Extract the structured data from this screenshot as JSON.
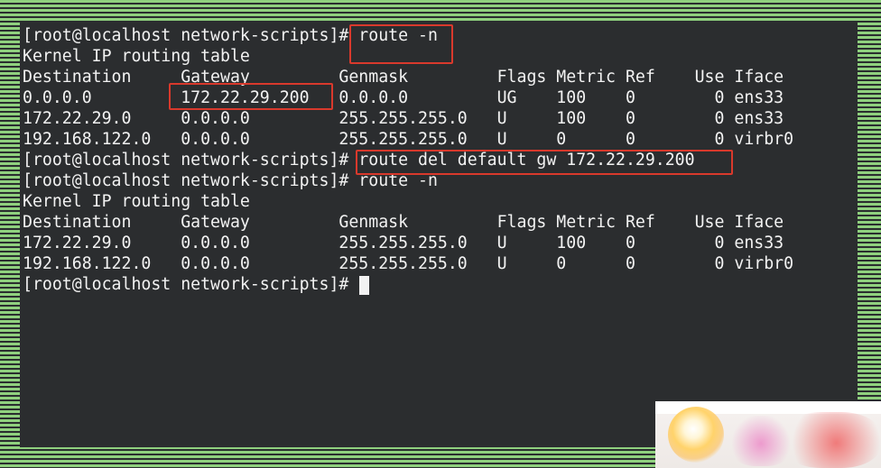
{
  "terminal": {
    "lines": [
      "[root@localhost network-scripts]# route -n",
      "Kernel IP routing table",
      "Destination     Gateway         Genmask         Flags Metric Ref    Use Iface",
      "0.0.0.0         172.22.29.200   0.0.0.0         UG    100    0        0 ens33",
      "172.22.29.0     0.0.0.0         255.255.255.0   U     100    0        0 ens33",
      "192.168.122.0   0.0.0.0         255.255.255.0   U     0      0        0 virbr0",
      "[root@localhost network-scripts]# route del default gw 172.22.29.200",
      "[root@localhost network-scripts]# route -n",
      "Kernel IP routing table",
      "Destination     Gateway         Genmask         Flags Metric Ref    Use Iface",
      "172.22.29.0     0.0.0.0         255.255.255.0   U     100    0        0 ens33",
      "192.168.122.0   0.0.0.0         255.255.255.0   U     0      0        0 virbr0",
      "[root@localhost network-scripts]# "
    ]
  },
  "colors": {
    "background": "#2b2d2f",
    "text": "#f2f2f2",
    "highlight": "#d9392c",
    "border_stripe": "#8fd07e"
  }
}
